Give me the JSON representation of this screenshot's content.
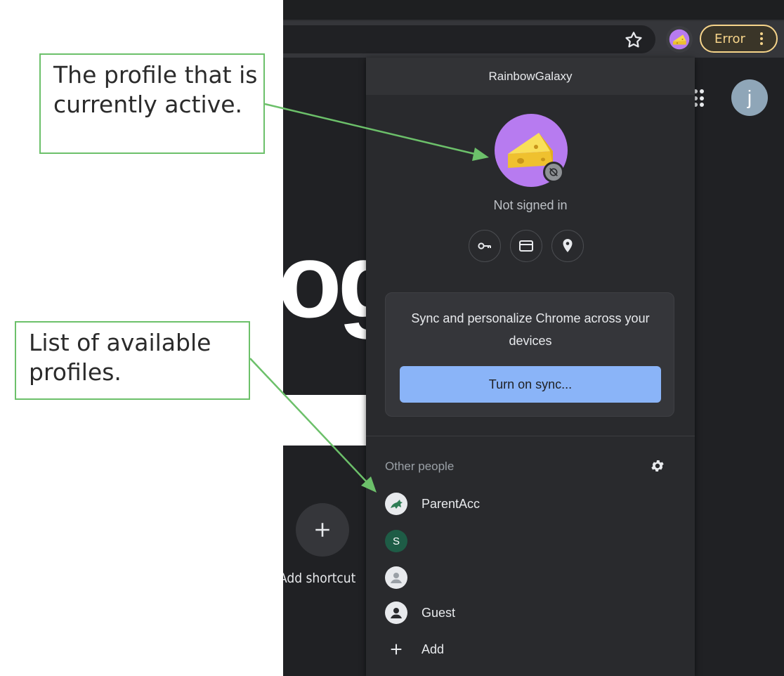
{
  "annotations": {
    "active_profile_note": "The profile that is currently active.",
    "profiles_list_note": "List of available profiles."
  },
  "toolbar": {
    "error_label": "Error"
  },
  "new_tab_page": {
    "logo_fragment": "ogl",
    "account_initial": "j",
    "add_shortcut_label": "Add shortcut"
  },
  "profile_menu": {
    "profile_name": "RainbowGalaxy",
    "status": "Not signed in",
    "quick_icons": [
      "key-icon",
      "credit-card-icon",
      "location-icon"
    ],
    "sync_message": "Sync and personalize Chrome across your devices",
    "sync_button_label": "Turn on sync...",
    "other_people_title": "Other people",
    "people": [
      {
        "name": "ParentAcc",
        "avatar": "dragon-avatar-icon"
      },
      {
        "name": "",
        "avatar": "S",
        "avatar_color": "#1e5c46"
      },
      {
        "name": "",
        "avatar": "default-person-icon"
      },
      {
        "name": "Guest",
        "avatar": "guest-person-icon"
      },
      {
        "name": "Add",
        "avatar": "plus-icon"
      }
    ]
  },
  "colors": {
    "annotation_border": "#6cc06a",
    "profile_avatar_bg": "#b77bf0",
    "sync_button": "#8ab4f8",
    "error_chip": "#f6d48a"
  }
}
